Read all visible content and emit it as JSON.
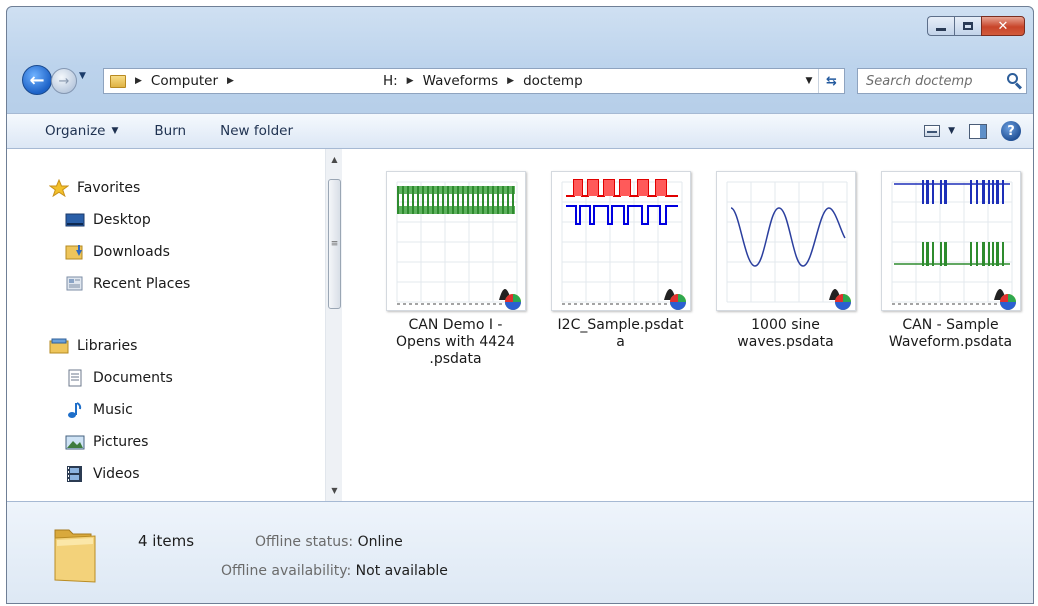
{
  "window": {
    "close_glyph": "✕"
  },
  "nav": {
    "address_crumbs": [
      "Computer",
      "H:",
      "Waveforms",
      "doctemp"
    ],
    "search_placeholder": "Search doctemp"
  },
  "commands": {
    "organize": "Organize",
    "burn": "Burn",
    "new_folder": "New folder"
  },
  "sidebar": {
    "favorites": {
      "label": "Favorites",
      "items": [
        "Desktop",
        "Downloads",
        "Recent Places"
      ]
    },
    "libraries": {
      "label": "Libraries",
      "items": [
        "Documents",
        "Music",
        "Pictures",
        "Videos"
      ]
    }
  },
  "files": [
    {
      "name": "CAN Demo I - Opens with 4424 .psdata",
      "lines": [
        "CAN Demo I -",
        "Opens with 4424",
        ".psdata"
      ],
      "icon": "psdata-waveform-thumbnail"
    },
    {
      "name": "I2C_Sample.psdata",
      "lines": [
        "I2C_Sample.psdat",
        "a"
      ],
      "icon": "psdata-waveform-thumbnail"
    },
    {
      "name": "1000 sine waves.psdata",
      "lines": [
        "1000 sine",
        "waves.psdata"
      ],
      "icon": "psdata-waveform-thumbnail"
    },
    {
      "name": "CAN - Sample Waveform.psdata",
      "lines": [
        "CAN - Sample",
        "Waveform.psdata"
      ],
      "icon": "psdata-waveform-thumbnail"
    }
  ],
  "details": {
    "count": "4 items",
    "offline_status_label": "Offline status:",
    "offline_status_value": "Online",
    "offline_availability_label": "Offline availability:",
    "offline_availability_value": "Not available"
  },
  "colors": {
    "accent": "#1d62c7",
    "can_trace": "#2e8b2e",
    "i2c_clock": "#e00000",
    "i2c_data": "#0000e0",
    "sine": "#2b3f9e"
  }
}
